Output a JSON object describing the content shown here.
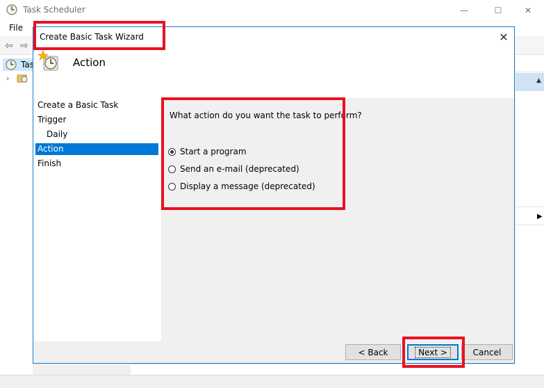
{
  "background_app": {
    "title": "Task Scheduler",
    "menu_file": "File",
    "tree_label": "Tas",
    "window_controls": {
      "minimize": "—",
      "maximize": "☐",
      "close": "✕"
    }
  },
  "dialog": {
    "title": "Create Basic Task Wizard",
    "close_glyph": "✕",
    "header_title": "Action",
    "steps": [
      {
        "label": "Create a Basic Task"
      },
      {
        "label": "Trigger"
      },
      {
        "label": "Daily"
      },
      {
        "label": "Action"
      },
      {
        "label": "Finish"
      }
    ],
    "question": "What action do you want the task to perform?",
    "options": [
      {
        "label": "Start a program",
        "checked": true
      },
      {
        "label": "Send an e-mail (deprecated)",
        "checked": false
      },
      {
        "label": "Display a message (deprecated)",
        "checked": false
      }
    ],
    "buttons": {
      "back": "< Back",
      "next": "Next >",
      "cancel": "Cancel"
    }
  },
  "colors": {
    "accent": "#0078d7",
    "annotation": "#e81123"
  },
  "icons": {
    "app": "clock-icon",
    "wizard_header": "clock-star-icon"
  }
}
